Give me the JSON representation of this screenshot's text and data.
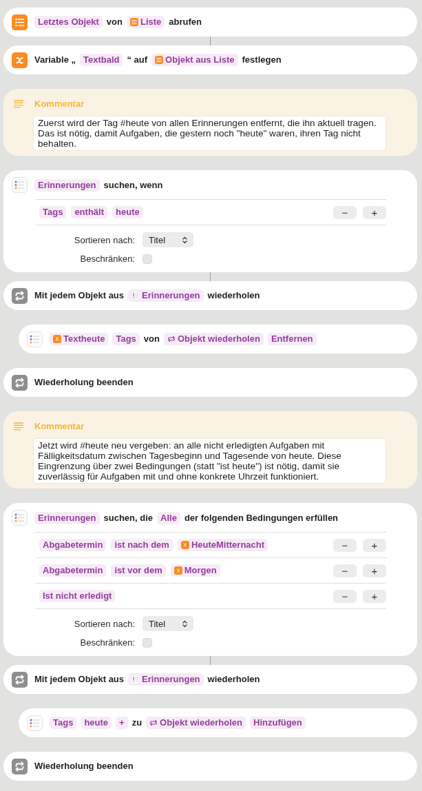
{
  "workflow": [
    {
      "kind": "get_item",
      "connected": false,
      "parts": [
        {
          "kind": "param",
          "text": "Letztes Objekt"
        },
        {
          "kind": "text",
          "text": "von"
        },
        {
          "kind": "list_var",
          "text": "Liste"
        },
        {
          "kind": "text",
          "text": "abrufen"
        }
      ]
    },
    {
      "kind": "set_variable",
      "connected": true,
      "parts": [
        {
          "kind": "text",
          "text": "Variable „"
        },
        {
          "kind": "param",
          "text": "Textbald"
        },
        {
          "kind": "text",
          "text": "“ auf"
        },
        {
          "kind": "list_var",
          "text": "Objekt aus Liste"
        },
        {
          "kind": "text",
          "text": "festlegen"
        }
      ]
    },
    {
      "kind": "comment",
      "connected": false,
      "title": "Kommentar",
      "text": "Zuerst wird der Tag #heute von allen Erinnerungen entfernt, die ihn aktuell tragen. Das ist nötig, damit Aufgaben, die gestern noch \"heute\" waren, ihren Tag nicht behalten."
    },
    {
      "kind": "find",
      "connected": false,
      "parts": [
        {
          "kind": "param",
          "text": "Erinnerungen"
        },
        {
          "kind": "text",
          "text": "suchen, wenn"
        }
      ],
      "conditions": [
        {
          "parts": [
            {
              "kind": "param",
              "text": "Tags"
            },
            {
              "kind": "param",
              "text": "enthält"
            },
            {
              "kind": "param",
              "text": "heute"
            }
          ],
          "buttons": [
            "−",
            "+"
          ]
        }
      ],
      "sort": {
        "label": "Sortieren nach:",
        "value": "Titel"
      },
      "limit": {
        "label": "Beschränken:",
        "checked": false
      }
    },
    {
      "kind": "repeat",
      "connected": true,
      "parts": [
        {
          "kind": "text",
          "text": "Mit jedem Objekt aus"
        },
        {
          "kind": "reminders_var",
          "text": "Erinnerungen"
        },
        {
          "kind": "text",
          "text": "wiederholen"
        }
      ],
      "children": [
        {
          "kind": "edit_reminder",
          "connected": false,
          "parts": [
            {
              "kind": "named_var",
              "text": "Textheute"
            },
            {
              "kind": "param",
              "text": "Tags"
            },
            {
              "kind": "text",
              "text": "von"
            },
            {
              "kind": "repeat_var",
              "text": "Objekt wiederholen"
            },
            {
              "kind": "param",
              "text": "Entfernen"
            }
          ]
        }
      ]
    },
    {
      "kind": "end_repeat",
      "connected": false,
      "parts": [
        {
          "kind": "text",
          "text": "Wiederholung beenden"
        }
      ]
    },
    {
      "kind": "comment",
      "connected": false,
      "title": "Kommentar",
      "text": "Jetzt wird #heute neu vergeben: an alle nicht erledigten Aufgaben mit Fälligkeitsdatum zwischen Tagesbeginn und Tagesende von heute. Diese Eingrenzung über zwei Bedingungen (statt \"ist heute\") ist nötig, damit sie zuverlässig für Aufgaben mit und ohne konkrete Uhrzeit funktioniert."
    },
    {
      "kind": "find",
      "connected": false,
      "parts": [
        {
          "kind": "param",
          "text": "Erinnerungen"
        },
        {
          "kind": "text",
          "text": "suchen, die"
        },
        {
          "kind": "param",
          "text": "Alle"
        },
        {
          "kind": "text",
          "text": "der folgenden Bedingungen erfüllen"
        }
      ],
      "conditions": [
        {
          "parts": [
            {
              "kind": "param",
              "text": "Abgabetermin"
            },
            {
              "kind": "param",
              "text": "ist nach dem"
            },
            {
              "kind": "named_var",
              "text": "HeuteMitternacht"
            }
          ],
          "buttons": [
            "−",
            "+"
          ]
        },
        {
          "parts": [
            {
              "kind": "param",
              "text": "Abgabetermin"
            },
            {
              "kind": "param",
              "text": "ist vor dem"
            },
            {
              "kind": "named_var",
              "text": "Morgen"
            }
          ],
          "buttons": [
            "−",
            "+"
          ]
        },
        {
          "parts": [
            {
              "kind": "param",
              "text": "Ist nicht erledigt"
            }
          ],
          "buttons": [
            "−",
            "+"
          ]
        }
      ],
      "sort": {
        "label": "Sortieren nach:",
        "value": "Titel"
      },
      "limit": {
        "label": "Beschränken:",
        "checked": false
      }
    },
    {
      "kind": "repeat",
      "connected": true,
      "parts": [
        {
          "kind": "text",
          "text": "Mit jedem Objekt aus"
        },
        {
          "kind": "reminders_var",
          "text": "Erinnerungen"
        },
        {
          "kind": "text",
          "text": "wiederholen"
        }
      ],
      "children": [
        {
          "kind": "edit_reminder",
          "connected": false,
          "parts": [
            {
              "kind": "param",
              "text": "Tags"
            },
            {
              "kind": "param",
              "text": "heute"
            },
            {
              "kind": "param",
              "text": "+"
            },
            {
              "kind": "text",
              "text": "zu"
            },
            {
              "kind": "repeat_var",
              "text": "Objekt wiederholen"
            },
            {
              "kind": "param",
              "text": "Hinzufügen"
            }
          ]
        }
      ]
    },
    {
      "kind": "end_repeat",
      "connected": false,
      "parts": [
        {
          "kind": "text",
          "text": "Wiederholung beenden"
        }
      ]
    }
  ]
}
